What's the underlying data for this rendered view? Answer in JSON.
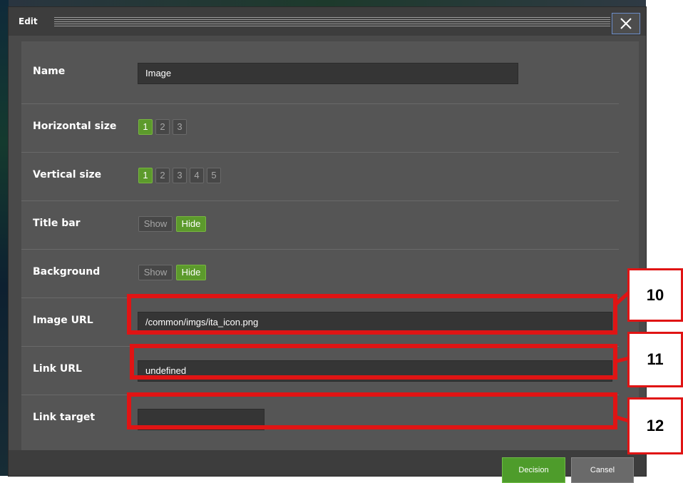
{
  "dialog": {
    "title": "Edit",
    "close_label": "×"
  },
  "form": {
    "name": {
      "label": "Name",
      "value": "Image"
    },
    "horizontal_size": {
      "label": "Horizontal size",
      "options": [
        "1",
        "2",
        "3"
      ],
      "selected": "1"
    },
    "vertical_size": {
      "label": "Vertical size",
      "options": [
        "1",
        "2",
        "3",
        "4",
        "5"
      ],
      "selected": "1"
    },
    "title_bar": {
      "label": "Title bar",
      "options": [
        "Show",
        "Hide"
      ],
      "selected": "Hide"
    },
    "background": {
      "label": "Background",
      "options": [
        "Show",
        "Hide"
      ],
      "selected": "Hide"
    },
    "image_url": {
      "label": "Image URL",
      "value": "/common/imgs/ita_icon.png"
    },
    "link_url": {
      "label": "Link URL",
      "value": "undefined"
    },
    "link_target": {
      "label": "Link target",
      "value": ""
    }
  },
  "annotations": [
    "10",
    "11",
    "12"
  ],
  "footer": {
    "decision_label": "Decision",
    "cancel_label": "Cansel"
  },
  "colors": {
    "selected": "#5c9a2c",
    "annotation": "#e01414",
    "dialog_bg": "#555555"
  }
}
